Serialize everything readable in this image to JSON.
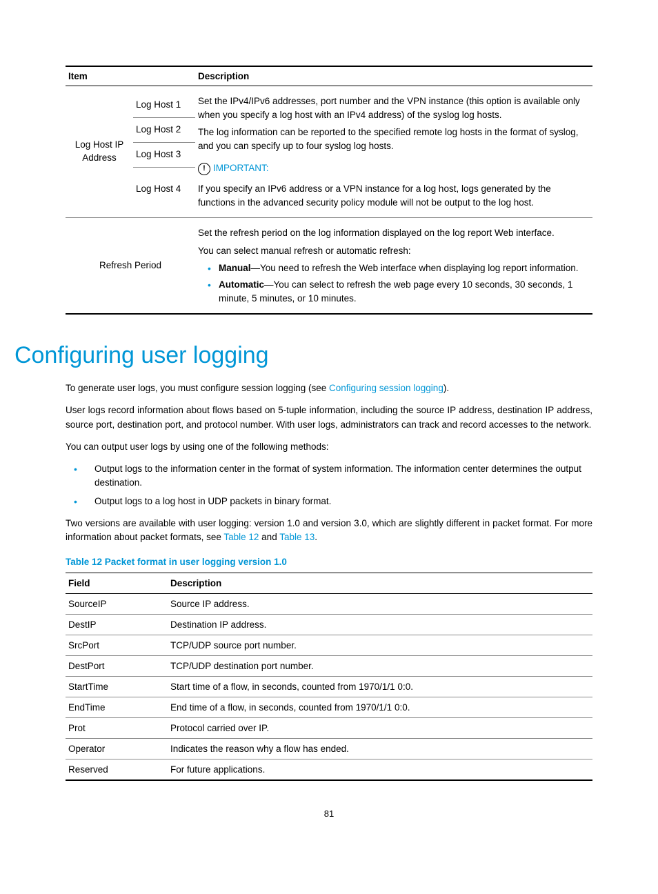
{
  "table1": {
    "headers": [
      "Item",
      "Description"
    ],
    "row_loghost": {
      "label": "Log Host IP Address",
      "hosts": [
        "Log Host 1",
        "Log Host 2",
        "Log Host 3",
        "Log Host 4"
      ],
      "desc": {
        "p1": "Set the IPv4/IPv6 addresses, port number and the VPN instance (this option is available only when you specify a log host with an IPv4 address) of the syslog log hosts.",
        "p2": "The log information can be reported to the specified remote log hosts in the format of syslog, and you can specify up to four syslog log hosts.",
        "important_label": "IMPORTANT:",
        "p3": "If you specify an IPv6 address or a VPN instance for a log host, logs generated by the functions in the advanced security policy module will not be output to the log host."
      }
    },
    "row_refresh": {
      "label": "Refresh Period",
      "desc": {
        "p1": "Set the refresh period on the log information displayed on the log report Web interface.",
        "p2": "You can select manual refresh or automatic refresh:",
        "bullets": [
          {
            "bold": "Manual",
            "rest": "—You need to refresh the Web interface when displaying log report information."
          },
          {
            "bold": "Automatic",
            "rest": "—You can select to refresh the web page every 10 seconds, 30 seconds, 1 minute, 5 minutes, or 10 minutes."
          }
        ]
      }
    }
  },
  "heading": "Configuring user logging",
  "p1_pre": "To generate user logs, you must configure session logging (see ",
  "p1_link": "Configuring session logging",
  "p1_post": ").",
  "p2": "User logs record information about flows based on 5-tuple information, including the source IP address, destination IP address, source port, destination port, and protocol number. With user logs, administrators can track and record accesses to the network.",
  "p3": "You can output user logs by using one of the following methods:",
  "out_bullets": [
    "Output logs to the information center in the format of system information. The information center determines the output destination.",
    "Output logs to a log host in UDP packets in binary format."
  ],
  "p4_pre": "Two versions are available with user logging: version 1.0 and version 3.0, which are slightly different in packet format. For more information about packet formats, see ",
  "p4_link1": "Table 12",
  "p4_mid": " and ",
  "p4_link2": "Table 13",
  "p4_post": ".",
  "table12_caption": "Table 12 Packet format in user logging version 1.0",
  "table12": {
    "headers": [
      "Field",
      "Description"
    ],
    "rows": [
      [
        "SourceIP",
        "Source IP address."
      ],
      [
        "DestIP",
        "Destination IP address."
      ],
      [
        "SrcPort",
        "TCP/UDP source port number."
      ],
      [
        "DestPort",
        "TCP/UDP destination port number."
      ],
      [
        "StartTime",
        "Start time of a flow, in seconds, counted from 1970/1/1 0:0."
      ],
      [
        "EndTime",
        "End time of a flow, in seconds, counted from 1970/1/1 0:0."
      ],
      [
        "Prot",
        "Protocol carried over IP."
      ],
      [
        "Operator",
        "Indicates the reason why a flow has ended."
      ],
      [
        "Reserved",
        "For future applications."
      ]
    ]
  },
  "pagenum": "81"
}
